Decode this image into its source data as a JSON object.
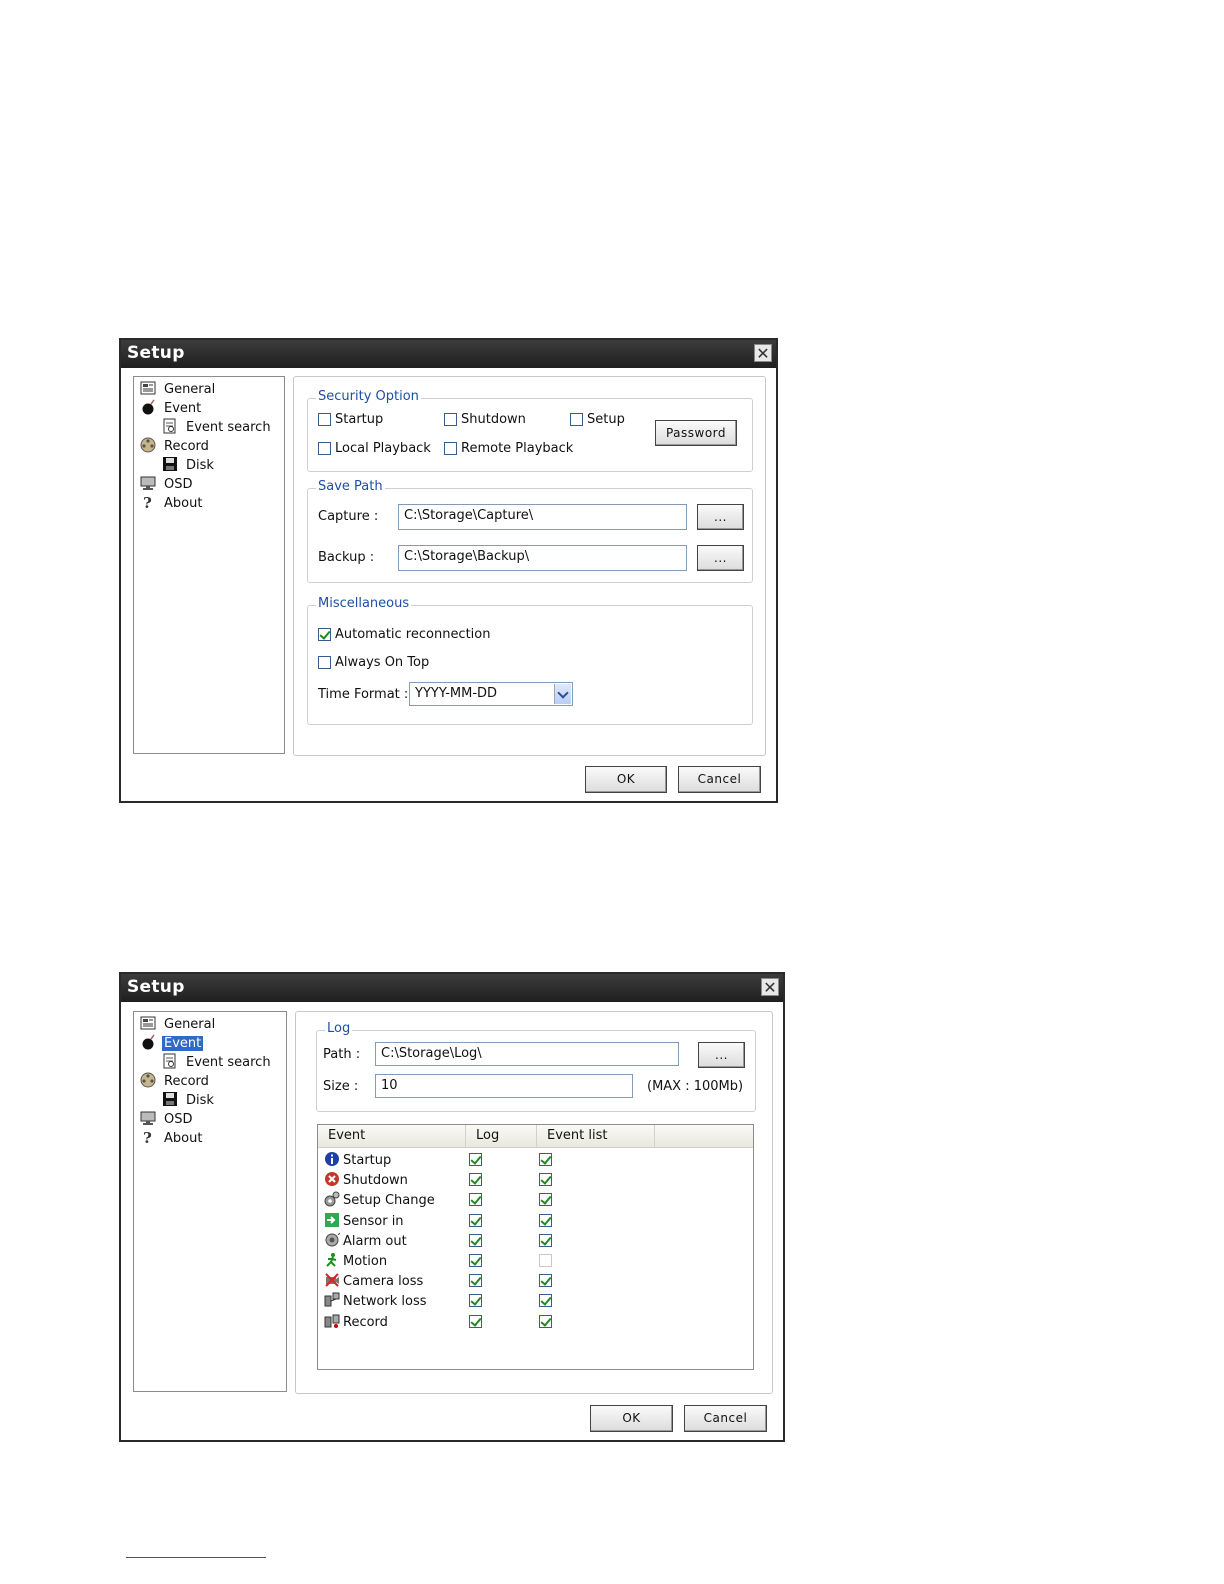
{
  "dialog1": {
    "title": "Setup",
    "close_icon": "close-icon",
    "tree": [
      {
        "label": "General",
        "icon": "general-icon"
      },
      {
        "label": "Event",
        "icon": "bomb-icon"
      },
      {
        "label": "Event search",
        "icon": "event-search-icon"
      },
      {
        "label": "Record",
        "icon": "film-reel-icon"
      },
      {
        "label": "Disk",
        "icon": "floppy-disk-icon"
      },
      {
        "label": "OSD",
        "icon": "monitor-icon"
      },
      {
        "label": "About",
        "icon": "question-icon"
      }
    ],
    "security": {
      "legend": "Security Option",
      "startup": "Startup",
      "shutdown": "Shutdown",
      "setup": "Setup",
      "local_playback": "Local Playback",
      "remote_playback": "Remote Playback",
      "password_button": "Password"
    },
    "save_path": {
      "legend": "Save Path",
      "capture_label": "Capture :",
      "capture_value": "C:\\Storage\\Capture\\",
      "backup_label": "Backup :",
      "backup_value": "C:\\Storage\\Backup\\",
      "browse_label": "..."
    },
    "misc": {
      "legend": "Miscellaneous",
      "auto_reconnect": "Automatic reconnection",
      "auto_reconnect_checked": true,
      "always_on_top": "Always On Top",
      "always_on_top_checked": false,
      "time_format_label": "Time Format :",
      "time_format_value": "YYYY-MM-DD"
    },
    "ok": "OK",
    "cancel": "Cancel"
  },
  "dialog2": {
    "title": "Setup",
    "close_icon": "close-icon",
    "tree": [
      {
        "label": "General",
        "icon": "general-icon"
      },
      {
        "label": "Event",
        "icon": "bomb-icon",
        "selected": true
      },
      {
        "label": "Event search",
        "icon": "event-search-icon"
      },
      {
        "label": "Record",
        "icon": "film-reel-icon"
      },
      {
        "label": "Disk",
        "icon": "floppy-disk-icon"
      },
      {
        "label": "OSD",
        "icon": "monitor-icon"
      },
      {
        "label": "About",
        "icon": "question-icon"
      }
    ],
    "log": {
      "legend": "Log",
      "path_label": "Path :",
      "path_value": "C:\\Storage\\Log\\",
      "browse_label": "...",
      "size_label": "Size :",
      "size_value": "10",
      "max_note": "(MAX : 100Mb)"
    },
    "table": {
      "columns": [
        "Event",
        "Log",
        "Event list"
      ],
      "rows": [
        {
          "event": "Startup",
          "icon": "info-icon",
          "log": true,
          "event_list": true
        },
        {
          "event": "Shutdown",
          "icon": "shutdown-icon",
          "log": true,
          "event_list": true
        },
        {
          "event": "Setup Change",
          "icon": "setup-change-icon",
          "log": true,
          "event_list": true
        },
        {
          "event": "Sensor in",
          "icon": "sensor-in-icon",
          "log": true,
          "event_list": true
        },
        {
          "event": "Alarm out",
          "icon": "alarm-out-icon",
          "log": true,
          "event_list": true
        },
        {
          "event": "Motion",
          "icon": "motion-icon",
          "log": true,
          "event_list": false
        },
        {
          "event": "Camera loss",
          "icon": "camera-loss-icon",
          "log": true,
          "event_list": true
        },
        {
          "event": "Network loss",
          "icon": "network-loss-icon",
          "log": true,
          "event_list": true
        },
        {
          "event": "Record",
          "icon": "record-icon",
          "log": true,
          "event_list": true
        }
      ]
    },
    "ok": "OK",
    "cancel": "Cancel"
  }
}
